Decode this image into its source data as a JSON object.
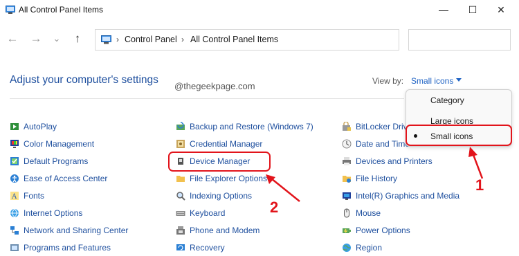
{
  "window": {
    "title": "All Control Panel Items",
    "controls": {
      "minimize": "—",
      "maximize": "☐",
      "close": "✕"
    }
  },
  "nav": {
    "back": "←",
    "forward": "→",
    "dropdown": "⌄",
    "up": "↑",
    "sep": "›",
    "breadcrumbs": [
      "Control Panel",
      "All Control Panel Items"
    ],
    "search_placeholder": ""
  },
  "main": {
    "heading": "Adjust your computer's settings",
    "watermark": "@thegeekpage.com",
    "view_by_label": "View by:",
    "view_by_value": "Small icons"
  },
  "dropdown": {
    "options": [
      "Category",
      "Large icons",
      "Small icons"
    ],
    "selected": "Small icons"
  },
  "items": {
    "col1": [
      "AutoPlay",
      "Color Management",
      "Default Programs",
      "Ease of Access Center",
      "Fonts",
      "Internet Options",
      "Network and Sharing Center",
      "Programs and Features"
    ],
    "col2": [
      "Backup and Restore (Windows 7)",
      "Credential Manager",
      "Device Manager",
      "File Explorer Options",
      "Indexing Options",
      "Keyboard",
      "Phone and Modem",
      "Recovery"
    ],
    "col3": [
      "BitLocker Drive Encryption",
      "Date and Time",
      "Devices and Printers",
      "File History",
      "Intel(R) Graphics and Media",
      "Mouse",
      "Power Options",
      "Region"
    ]
  },
  "annotations": {
    "one": "1",
    "two": "2"
  },
  "colors": {
    "link": "#1e4f9e",
    "callout": "#e2141b",
    "heading": "#1e4f9e"
  }
}
